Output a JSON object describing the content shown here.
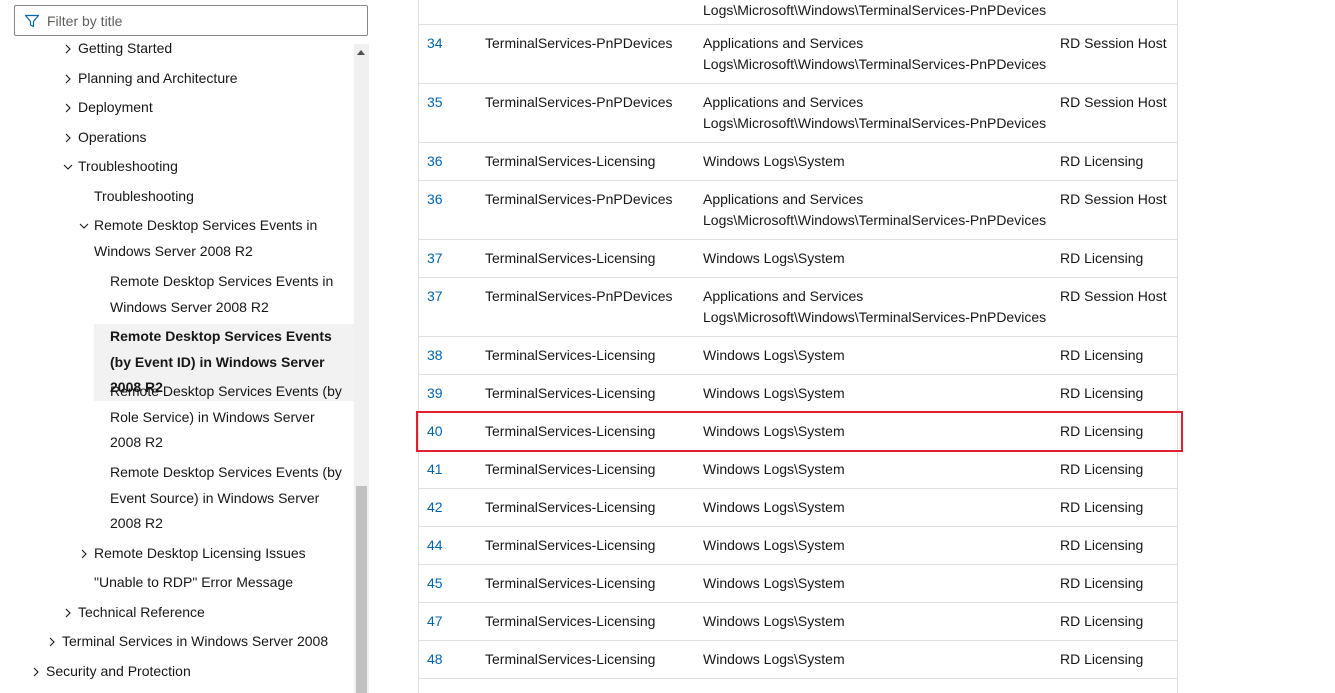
{
  "filter": {
    "placeholder": "Filter by title",
    "icon": "filter-icon"
  },
  "toc": {
    "items": [
      {
        "label": "Getting Started",
        "expander": "collapsed"
      },
      {
        "label": "Planning and Architecture",
        "expander": "collapsed"
      },
      {
        "label": "Deployment",
        "expander": "collapsed"
      },
      {
        "label": "Operations",
        "expander": "collapsed"
      },
      {
        "label": "Troubleshooting",
        "expander": "expanded"
      },
      {
        "label": "Troubleshooting",
        "expander": "none"
      },
      {
        "label": "Remote Desktop Services Events in Windows Server 2008 R2",
        "expander": "expanded"
      },
      {
        "label": "Remote Desktop Services Events in Windows Server 2008 R2",
        "expander": "none"
      },
      {
        "label": "Remote Desktop Services Events (by Event ID) in Windows Server 2008 R2",
        "expander": "none",
        "selected": true
      },
      {
        "label": "Remote Desktop Services Events (by Role Service) in Windows Server 2008 R2",
        "expander": "none"
      },
      {
        "label": "Remote Desktop Services Events (by Event Source) in Windows Server 2008 R2",
        "expander": "none"
      },
      {
        "label": "Remote Desktop Licensing Issues",
        "expander": "collapsed"
      },
      {
        "label": "\"Unable to RDP\" Error Message",
        "expander": "none"
      },
      {
        "label": "Technical Reference",
        "expander": "collapsed"
      },
      {
        "label": "Terminal Services in Windows Server 2008",
        "expander": "collapsed"
      },
      {
        "label": "Security and Protection",
        "expander": "collapsed"
      }
    ]
  },
  "table": {
    "partial_top_text": "Logs\\Microsoft\\Windows\\TerminalServices-PnPDevices",
    "rows": [
      {
        "id": "34",
        "source": "TerminalServices-PnPDevices",
        "log": "Applications and Services Logs\\Microsoft\\Windows\\TerminalServices-PnPDevices",
        "role_service": "RD Session Host"
      },
      {
        "id": "35",
        "source": "TerminalServices-PnPDevices",
        "log": "Applications and Services Logs\\Microsoft\\Windows\\TerminalServices-PnPDevices",
        "role_service": "RD Session Host"
      },
      {
        "id": "36",
        "source": "TerminalServices-Licensing",
        "log": "Windows Logs\\System",
        "role_service": "RD Licensing"
      },
      {
        "id": "36",
        "source": "TerminalServices-PnPDevices",
        "log": "Applications and Services Logs\\Microsoft\\Windows\\TerminalServices-PnPDevices",
        "role_service": "RD Session Host"
      },
      {
        "id": "37",
        "source": "TerminalServices-Licensing",
        "log": "Windows Logs\\System",
        "role_service": "RD Licensing"
      },
      {
        "id": "37",
        "source": "TerminalServices-PnPDevices",
        "log": "Applications and Services Logs\\Microsoft\\Windows\\TerminalServices-PnPDevices",
        "role_service": "RD Session Host"
      },
      {
        "id": "38",
        "source": "TerminalServices-Licensing",
        "log": "Windows Logs\\System",
        "role_service": "RD Licensing"
      },
      {
        "id": "39",
        "source": "TerminalServices-Licensing",
        "log": "Windows Logs\\System",
        "role_service": "RD Licensing"
      },
      {
        "id": "40",
        "source": "TerminalServices-Licensing",
        "log": "Windows Logs\\System",
        "role_service": "RD Licensing",
        "highlighted": true
      },
      {
        "id": "41",
        "source": "TerminalServices-Licensing",
        "log": "Windows Logs\\System",
        "role_service": "RD Licensing"
      },
      {
        "id": "42",
        "source": "TerminalServices-Licensing",
        "log": "Windows Logs\\System",
        "role_service": "RD Licensing"
      },
      {
        "id": "44",
        "source": "TerminalServices-Licensing",
        "log": "Windows Logs\\System",
        "role_service": "RD Licensing"
      },
      {
        "id": "45",
        "source": "TerminalServices-Licensing",
        "log": "Windows Logs\\System",
        "role_service": "RD Licensing"
      },
      {
        "id": "47",
        "source": "TerminalServices-Licensing",
        "log": "Windows Logs\\System",
        "role_service": "RD Licensing"
      },
      {
        "id": "48",
        "source": "TerminalServices-Licensing",
        "log": "Windows Logs\\System",
        "role_service": "RD Licensing"
      }
    ]
  },
  "colors": {
    "link": "#0065b3",
    "highlight_border": "#e0202e",
    "selected_bg": "#f2f2f2"
  }
}
